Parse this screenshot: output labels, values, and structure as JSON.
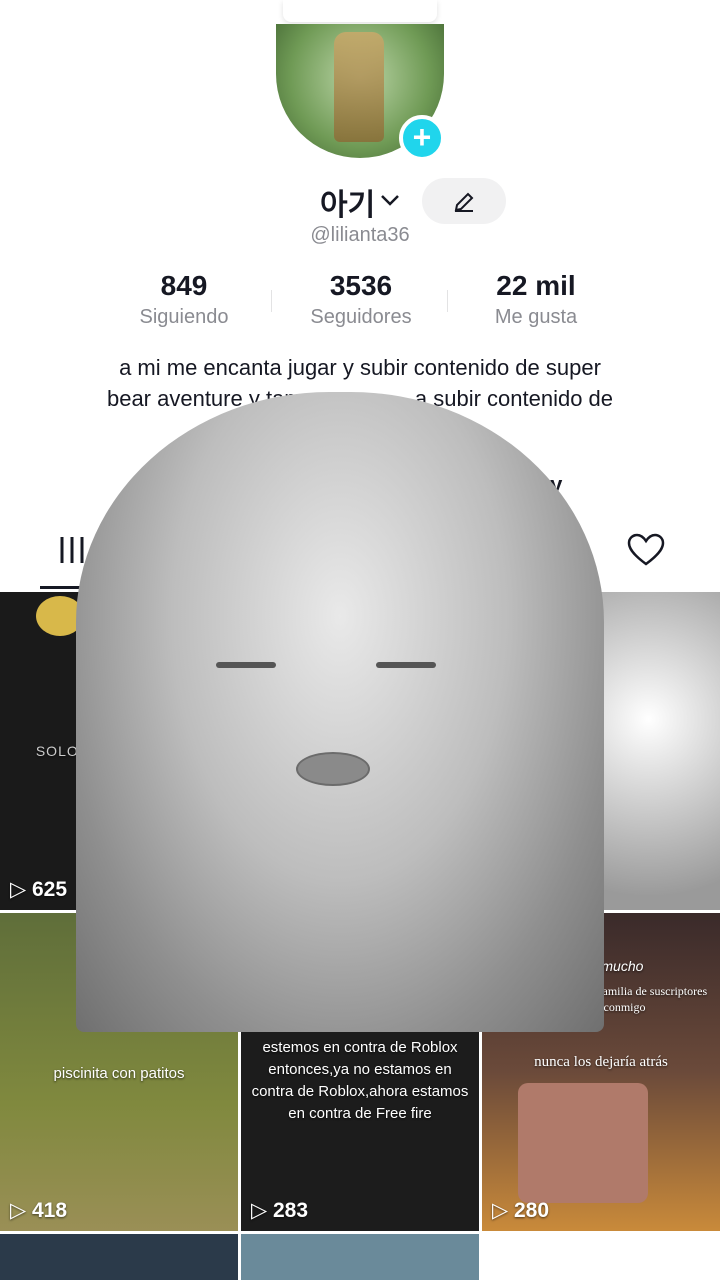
{
  "profile": {
    "display_name": "아기",
    "username": "@lilianta36",
    "add_icon": "plus-icon",
    "edit_icon": "pencil-icon",
    "name_chevron_icon": "chevron-down-icon"
  },
  "stats": [
    {
      "value": "849",
      "label": "Siguiendo"
    },
    {
      "value": "3536",
      "label": "Seguidores"
    },
    {
      "value": "22 mil",
      "label": "Me gusta"
    }
  ],
  "bio": {
    "line1": "a mi me encanta jugar y subir contenido de super",
    "line2_start": "bear aventure y tam",
    "line2_end": "a subir contenido de"
  },
  "links": {
    "right_label": "history",
    "left_icon": "add-friends-icon"
  },
  "tabs": [
    {
      "icon": "grid-icon"
    },
    {
      "icon": "sparkle-icon"
    },
    {
      "icon": "bookmark-icon"
    },
    {
      "icon": "heart-icon"
    }
  ],
  "videos": [
    {
      "views": "625",
      "caption": "SOLO TE QUIERO A TI"
    },
    {
      "views": "",
      "caption": ""
    },
    {
      "views": "",
      "caption": ""
    },
    {
      "views": "418",
      "caption": "piscinita con patitos"
    },
    {
      "views": "283",
      "caption": "estemos en contra de Roblox entonces,ya no estamos en contra de Roblox,ahora estamos en contra de Free fire"
    },
    {
      "views": "280",
      "caption": "nunca los dejaría atrás",
      "top_caption": "quiero mucho",
      "top_caption2": "siempre seremos una familia de suscriptores contando conmigo"
    }
  ],
  "colors": {
    "accent_cyan": "#20d5ec",
    "text_primary": "#161823",
    "text_secondary": "#8a8b91",
    "accent_red": "#fe2c55"
  }
}
